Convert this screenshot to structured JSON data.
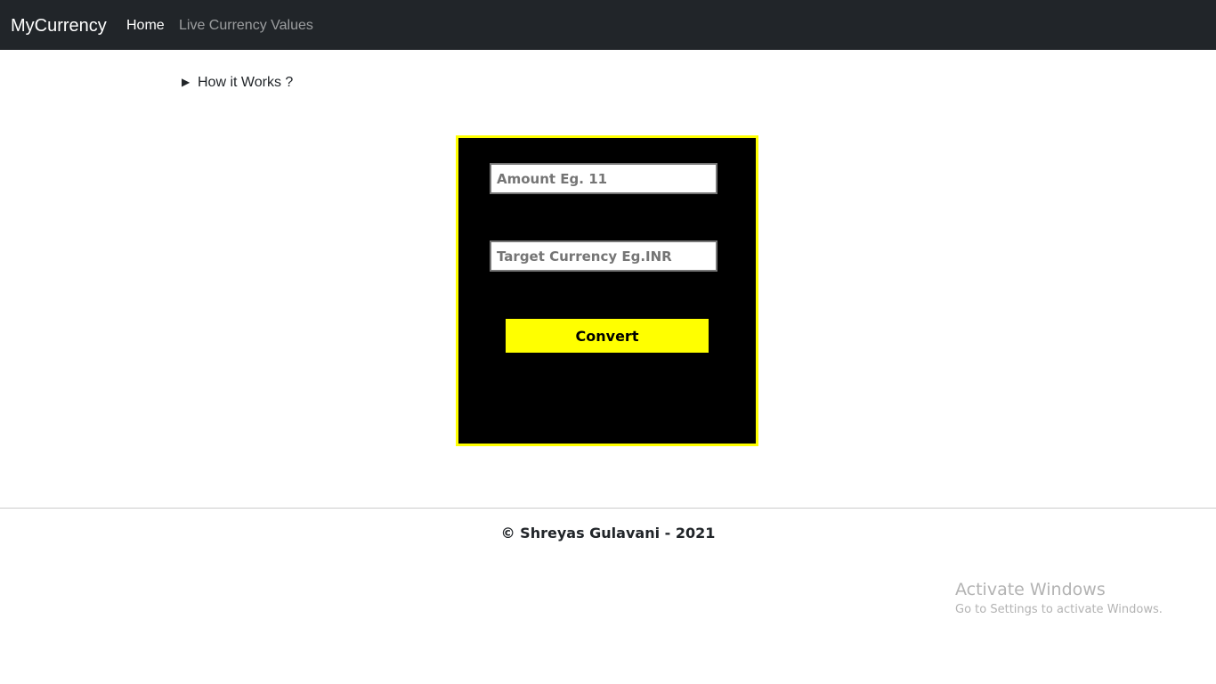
{
  "navbar": {
    "brand": "MyCurrency",
    "links": [
      {
        "label": "Home",
        "active": true
      },
      {
        "label": "Live Currency Values",
        "active": false
      }
    ],
    "background": "#212529"
  },
  "how_it_works": {
    "marker": "▶",
    "label": "How it Works ?"
  },
  "converter": {
    "amount_placeholder": "Amount Eg. 11",
    "amount_value": "",
    "target_placeholder": "Target Currency Eg.INR",
    "target_value": "",
    "convert_label": "Convert",
    "background": "#000000",
    "accent": "#ffff00"
  },
  "footer": {
    "text": "© Shreyas Gulavani - 2021"
  },
  "watermark": {
    "title": "Activate Windows",
    "subtitle": "Go to Settings to activate Windows."
  }
}
